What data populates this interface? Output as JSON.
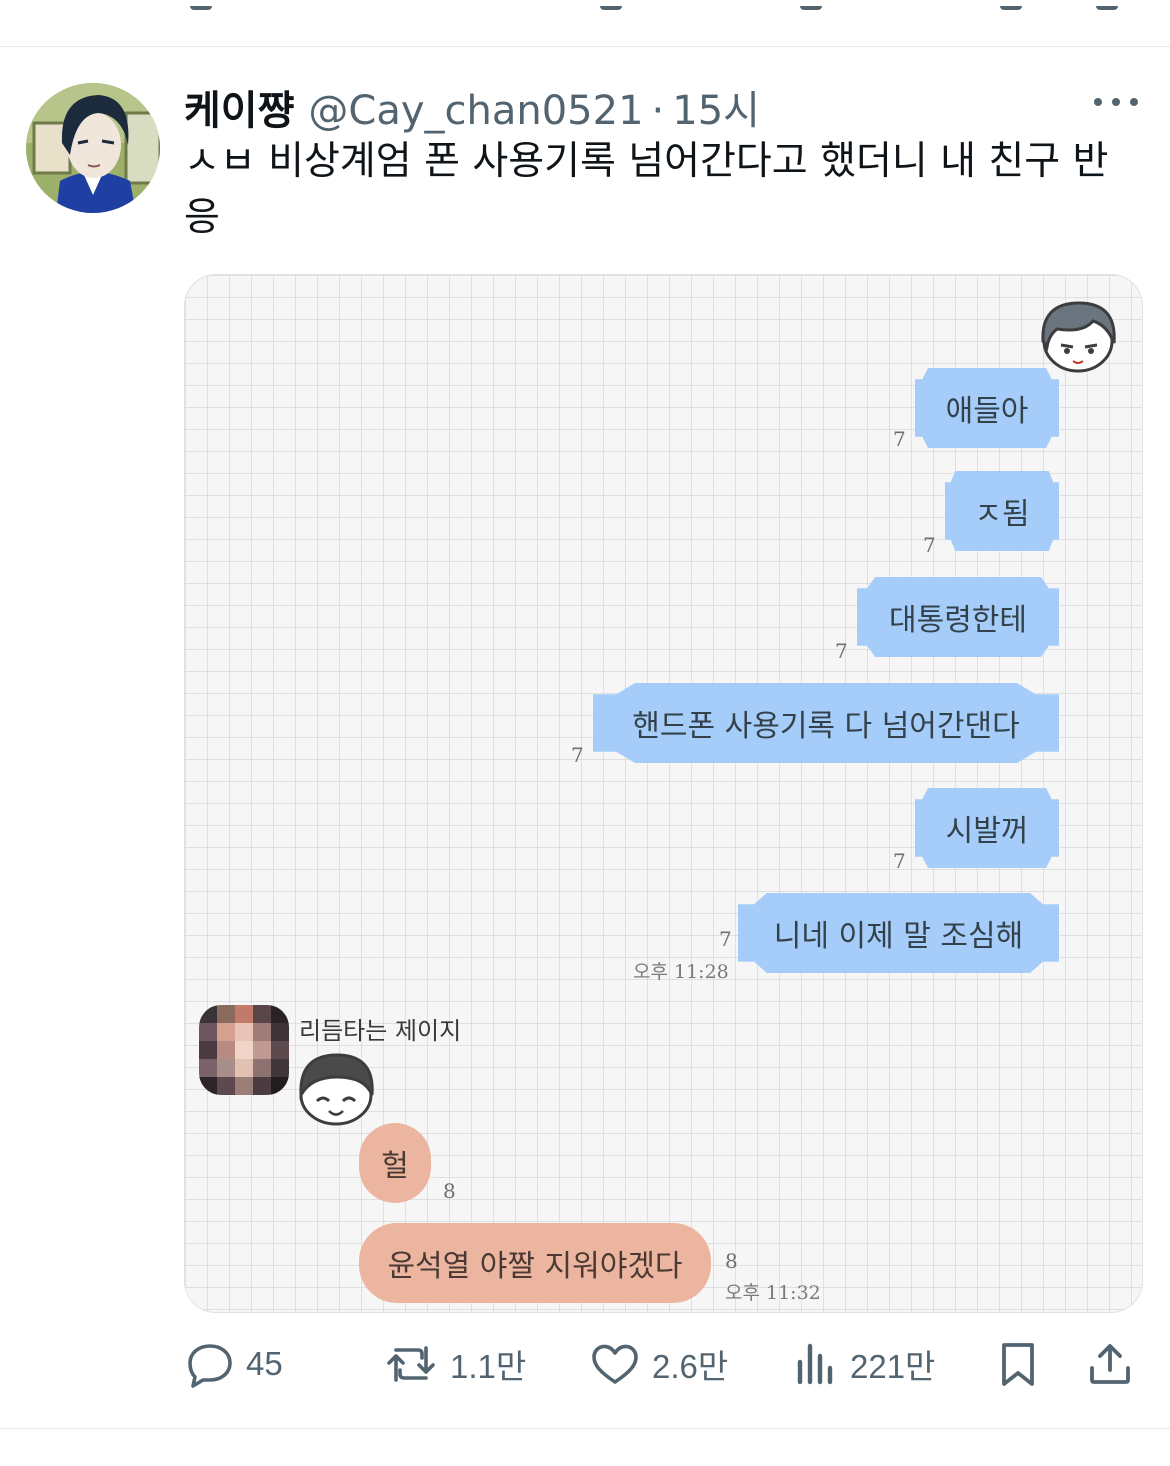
{
  "post": {
    "display_name": "케이쨩",
    "handle": "@Cay_chan0521",
    "separator": "·",
    "time": "15시",
    "text": "ㅅㅂ 비상계엄 폰 사용기록 넘어간다고 했더니 내 친구 반응"
  },
  "chat": {
    "sent_messages": [
      {
        "text": "애들아",
        "read_count": "7"
      },
      {
        "text": "ㅈ됨",
        "read_count": "7"
      },
      {
        "text": "대통령한테",
        "read_count": "7"
      },
      {
        "text": "핸드폰 사용기록 다 넘어간댄다",
        "read_count": "7"
      },
      {
        "text": "시발꺼",
        "read_count": "7"
      },
      {
        "text": "니네 이제 말 조심해",
        "read_count": "7",
        "timestamp": "오후 11:28"
      }
    ],
    "friend_name": "리듬타는 제이지",
    "received_messages": [
      {
        "text": "헐",
        "read_count": "8"
      },
      {
        "text": "윤석열 야짤 지워야겠다",
        "read_count": "8",
        "timestamp": "오후 11:32"
      }
    ],
    "colors": {
      "sent_bubble": "#a6cdf9",
      "received_bubble": "#ecb5a0",
      "grid_background": "#f6f6f7"
    }
  },
  "actions": {
    "replies": "45",
    "reposts": "1.1만",
    "likes": "2.6만",
    "views": "221만"
  },
  "icons": [
    "more-icon",
    "reply-icon",
    "repost-icon",
    "like-icon",
    "views-icon",
    "bookmark-icon",
    "share-icon"
  ],
  "colors": {
    "text_primary": "#0f1419",
    "text_secondary": "#536471",
    "divider": "#e6e9ec"
  }
}
